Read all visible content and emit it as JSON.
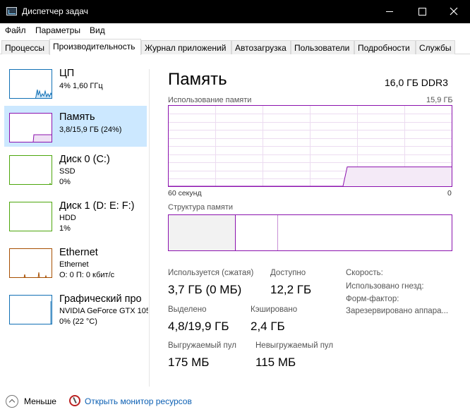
{
  "window": {
    "title": "Диспетчер задач"
  },
  "menu": [
    "Файл",
    "Параметры",
    "Вид"
  ],
  "tabs": [
    "Процессы",
    "Производительность",
    "Журнал приложений",
    "Автозагрузка",
    "Пользователи",
    "Подробности",
    "Службы"
  ],
  "active_tab": "Производительность",
  "resources": [
    {
      "name": "ЦП",
      "line1": "4% 1,60 ГГц",
      "line2": ""
    },
    {
      "name": "Память",
      "line1": "3,8/15,9 ГБ (24%)",
      "line2": ""
    },
    {
      "name": "Диск 0 (C:)",
      "line1": "SSD",
      "line2": "0%"
    },
    {
      "name": "Диск 1 (D: E: F:)",
      "line1": "HDD",
      "line2": "1%"
    },
    {
      "name": "Ethernet",
      "line1": "Ethernet",
      "line2": "О: 0 П: 0 кбит/с"
    },
    {
      "name": "Графический про",
      "line1": "NVIDIA GeForce GTX 105",
      "line2": "0% (22 °C)"
    }
  ],
  "memory": {
    "title": "Память",
    "spec": "16,0 ГБ DDR3",
    "usage_label": "Использование памяти",
    "usage_max": "15,9 ГБ",
    "time_left": "60 секунд",
    "time_right": "0",
    "structure_label": "Структура памяти",
    "usage_fraction_before": 0,
    "usage_fraction_after": 0.24,
    "stats": {
      "in_use_label": "Используется (сжатая)",
      "in_use_value": "3,7 ГБ (0 МБ)",
      "available_label": "Доступно",
      "available_value": "12,2 ГБ",
      "committed_label": "Выделено",
      "committed_value": "4,8/19,9 ГБ",
      "cached_label": "Кэшировано",
      "cached_value": "2,4 ГБ",
      "paged_label": "Выгружаемый пул",
      "paged_value": "175 МБ",
      "nonpaged_label": "Невыгружаемый пул",
      "nonpaged_value": "115 МБ"
    },
    "side": {
      "speed": "Скорость:",
      "slots": "Использовано гнезд:",
      "form": "Форм-фактор:",
      "reserved": "Зарезервировано аппара..."
    }
  },
  "bottom": {
    "fewer": "Меньше",
    "monitor": "Открыть монитор ресурсов"
  },
  "colors": {
    "memory_accent": "#8b12ae",
    "cpu_accent": "#1170b5",
    "disk_accent": "#4da60c",
    "ethernet_accent": "#a74f01",
    "selected_bg": "#cce8ff",
    "link": "#0b5fb3"
  }
}
